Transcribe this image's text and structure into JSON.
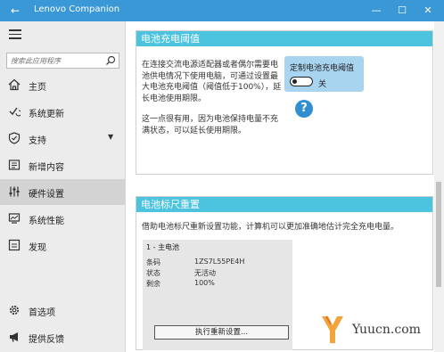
{
  "window": {
    "title": "Lenovo Companion",
    "back_glyph": "←",
    "minimize_glyph": "—",
    "maximize_glyph": "☐",
    "close_glyph": "✕",
    "accent": "#3b98d6"
  },
  "sidebar": {
    "search_placeholder": "搜索此应用程序",
    "items": [
      {
        "label": "主页",
        "icon": "home-icon"
      },
      {
        "label": "系统更新",
        "icon": "update-icon"
      },
      {
        "label": "支持",
        "icon": "shield-icon"
      },
      {
        "label": "新增内容",
        "icon": "news-icon"
      },
      {
        "label": "硬件设置",
        "icon": "sliders-icon"
      },
      {
        "label": "系统性能",
        "icon": "monitor-icon"
      },
      {
        "label": "发现",
        "icon": "discover-icon"
      }
    ],
    "bottom_items": [
      {
        "label": "首选项",
        "icon": "gear-icon"
      },
      {
        "label": "提供反馈",
        "icon": "megaphone-icon"
      }
    ],
    "support_chevron": "▼",
    "active_index": 4
  },
  "threshold_panel": {
    "title": "电池充电阈值",
    "description": "在连接交流电源适配器或者偶尔需要电池供电情况下使用电脑，可通过设置最大电池充电阈值（阈值低于100%），延长电池使用期限。",
    "description2": "这一点很有用，因为电池保持电量不充满状态，可以延长使用期限。",
    "toggle_label": "定制电池充电阈值",
    "toggle_state": "关",
    "toggle_on": false,
    "help_glyph": "?"
  },
  "gauge_panel": {
    "title": "电池标尺重置",
    "description": "借助电池标尺重新设置功能，计算机可以更加准确地估计完全充电电量。",
    "battery": {
      "title": "1 - 主电池",
      "rows": [
        {
          "label": "条码",
          "value": "1ZS7L55PE4H"
        },
        {
          "label": "状态",
          "value": "无活动"
        },
        {
          "label": "剩余",
          "value": "100%"
        }
      ]
    },
    "reset_button": "执行重新设置..."
  },
  "watermark": {
    "text": "Yuucn.com"
  }
}
